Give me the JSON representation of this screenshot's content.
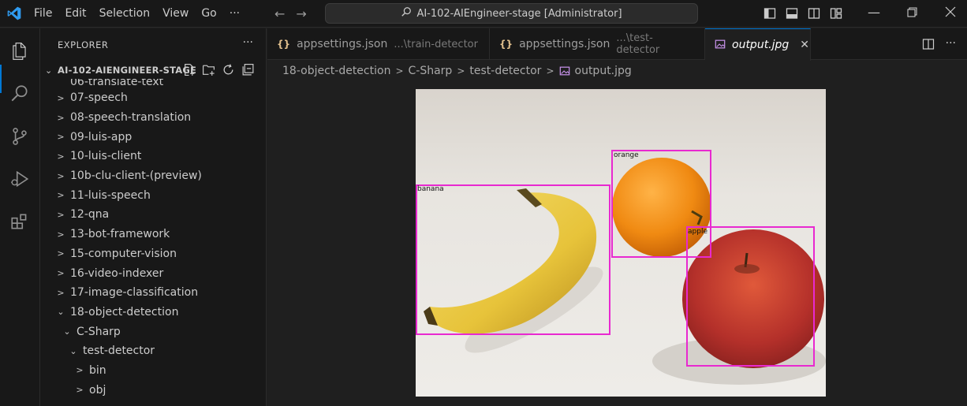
{
  "titlebar": {
    "menu": [
      "File",
      "Edit",
      "Selection",
      "View",
      "Go",
      "···"
    ],
    "search_text": "AI-102-AIEngineer-stage [Administrator]"
  },
  "sidebar": {
    "title": "EXPLORER",
    "more": "···",
    "section_name": "AI-102-AIENGINEER-STAGE",
    "partial_item": "06-translate-text",
    "items": [
      {
        "label": "07-speech",
        "expanded": false,
        "depth": 0
      },
      {
        "label": "08-speech-translation",
        "expanded": false,
        "depth": 0
      },
      {
        "label": "09-luis-app",
        "expanded": false,
        "depth": 0
      },
      {
        "label": "10-luis-client",
        "expanded": false,
        "depth": 0
      },
      {
        "label": "10b-clu-client-(preview)",
        "expanded": false,
        "depth": 0
      },
      {
        "label": "11-luis-speech",
        "expanded": false,
        "depth": 0
      },
      {
        "label": "12-qna",
        "expanded": false,
        "depth": 0
      },
      {
        "label": "13-bot-framework",
        "expanded": false,
        "depth": 0
      },
      {
        "label": "15-computer-vision",
        "expanded": false,
        "depth": 0
      },
      {
        "label": "16-video-indexer",
        "expanded": false,
        "depth": 0
      },
      {
        "label": "17-image-classification",
        "expanded": false,
        "depth": 0
      },
      {
        "label": "18-object-detection",
        "expanded": true,
        "depth": 0
      },
      {
        "label": "C-Sharp",
        "expanded": true,
        "depth": 1
      },
      {
        "label": "test-detector",
        "expanded": true,
        "depth": 2
      },
      {
        "label": "bin",
        "expanded": false,
        "depth": 3
      },
      {
        "label": "obj",
        "expanded": false,
        "depth": 3
      }
    ]
  },
  "tabs": [
    {
      "icon": "{}",
      "name": "appsettings.json",
      "desc": "...\\train-detector",
      "active": false
    },
    {
      "icon": "{}",
      "name": "appsettings.json",
      "desc": "...\\test-detector",
      "active": false
    },
    {
      "icon": "image-file",
      "name": "output.jpg",
      "desc": "",
      "active": true
    }
  ],
  "tab_close": "✕",
  "breadcrumb": [
    "18-object-detection",
    "C-Sharp",
    "test-detector",
    "output.jpg"
  ],
  "detections": [
    {
      "label": "banana"
    },
    {
      "label": "orange"
    },
    {
      "label": "apple"
    }
  ],
  "colors": {
    "accent": "#0078d4",
    "bbox": "#e829d0",
    "json_icon": "#e2c08d"
  }
}
